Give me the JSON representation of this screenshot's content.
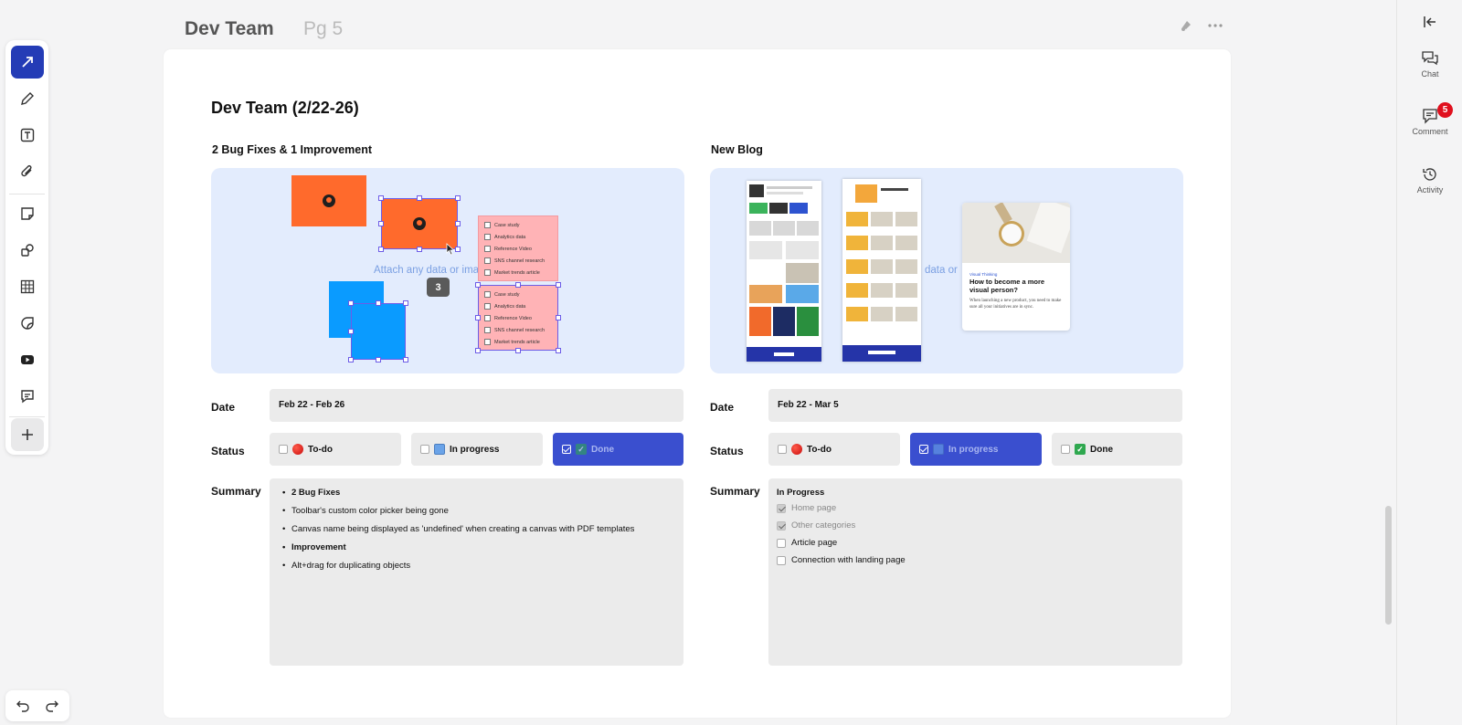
{
  "header": {
    "title": "Dev Team",
    "page": "Pg 5"
  },
  "toolbar": {
    "tools": [
      "select-tool",
      "pen-tool",
      "text-tool",
      "attach-tool",
      "sticky-note-tool",
      "shapes-tool",
      "table-tool",
      "sticker-tool",
      "video-tool",
      "comment-tool",
      "add-tool"
    ]
  },
  "right_panel": {
    "chat_label": "Chat",
    "comment_label": "Comment",
    "comment_badge": "5",
    "activity_label": "Activity"
  },
  "doc": {
    "title": "Dev Team (2/22-26)"
  },
  "left": {
    "title": "2 Bug Fixes & 1 Improvement",
    "attach_text": "Attach any data or ima",
    "selection_count": "3",
    "checklist_items": [
      "Case study",
      "Analytics data",
      "Reference Video",
      "SNS channel research",
      "Market trends article"
    ],
    "date_label": "Date",
    "date_value": "Feb 22 - Feb 26",
    "status_label": "Status",
    "status_options": [
      "To-do",
      "In progress",
      "Done"
    ],
    "status_selected": "Done",
    "summary_label": "Summary",
    "summary_items": [
      {
        "text": "2 Bug Fixes",
        "bold": true
      },
      {
        "text": "Toolbar's custom color picker being gone",
        "bold": false
      },
      {
        "text": "Canvas name being displayed as 'undefined' when creating a canvas with PDF templates",
        "bold": false
      },
      {
        "text": "Improvement",
        "bold": true
      },
      {
        "text": "Alt+drag for duplicating objects",
        "bold": false
      }
    ]
  },
  "right": {
    "title": "New Blog",
    "attach_text": "data or",
    "blog_card": {
      "tag": "Visual Thinking",
      "headline": "How to become a more visual person?",
      "body": "When launching a new product, you need to make sure all your initiatives are in sync."
    },
    "date_label": "Date",
    "date_value": "Feb 22 - Mar 5",
    "status_label": "Status",
    "status_options": [
      "To-do",
      "In progress",
      "Done"
    ],
    "status_selected": "In progress",
    "summary_label": "Summary",
    "summary_heading": "In Progress",
    "checklist": [
      {
        "text": "Home page",
        "checked": true
      },
      {
        "text": "Other categories",
        "checked": true
      },
      {
        "text": "Article page",
        "checked": false
      },
      {
        "text": "Connection with landing page",
        "checked": false
      }
    ]
  },
  "colors": {
    "accent": "#243cb6",
    "selected_status": "#3a4fcf",
    "image_bg": "#e3ecfd",
    "orange": "#ff6a2c",
    "blue": "#0a9bff",
    "badge": "#e0101e"
  }
}
